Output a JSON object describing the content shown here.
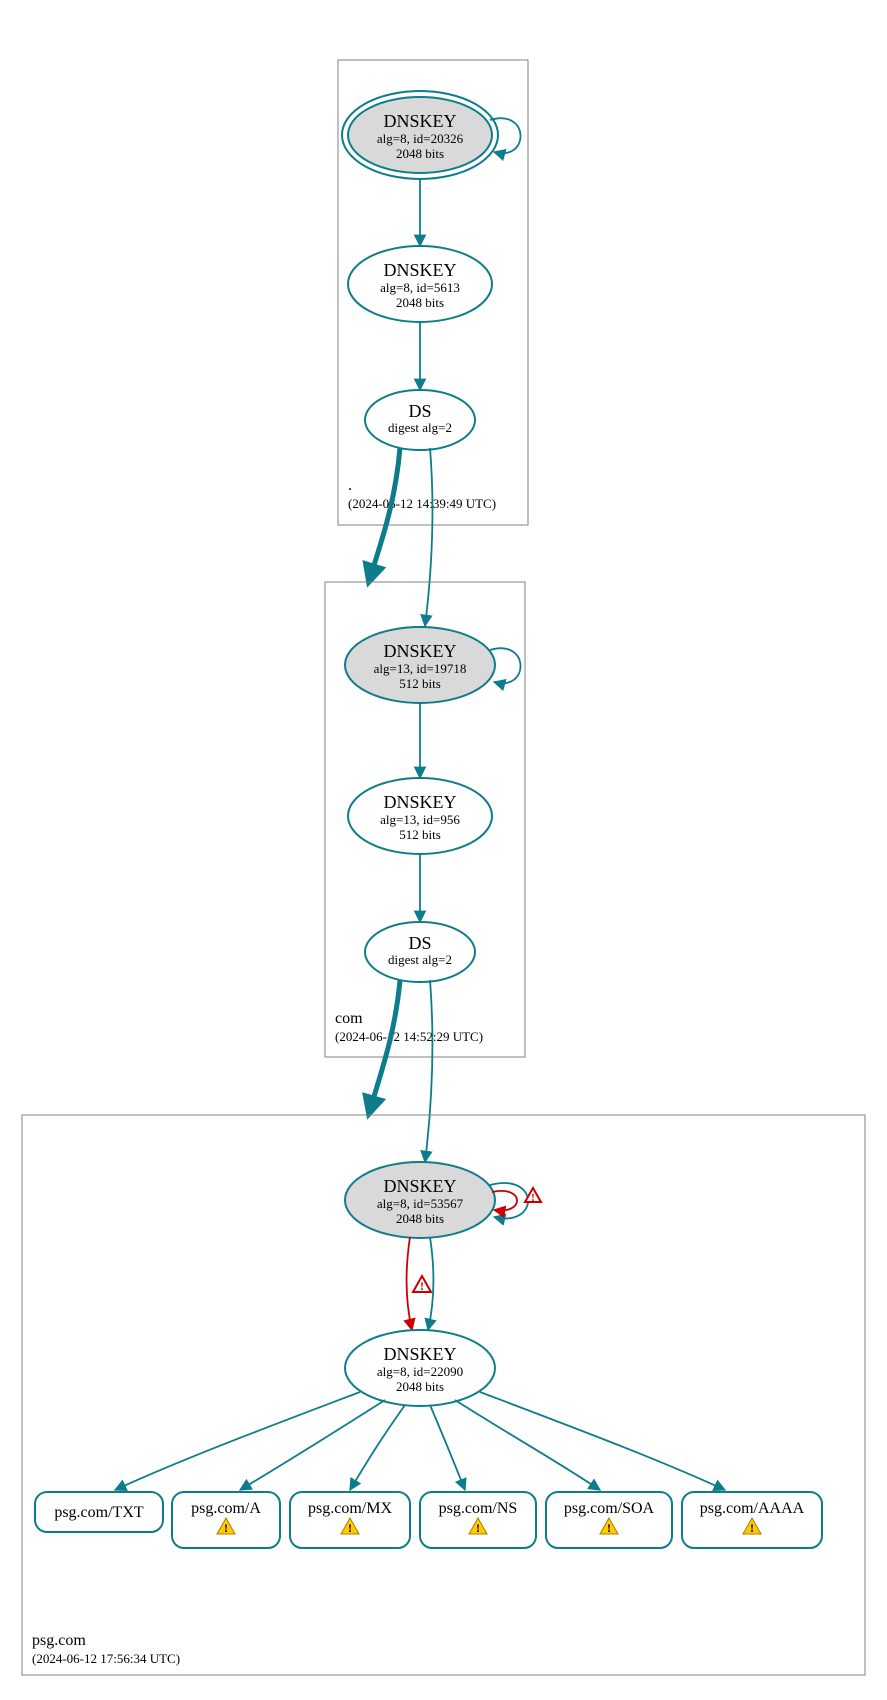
{
  "zones": {
    "root": {
      "label": ".",
      "timestamp": "(2024-06-12 14:39:49 UTC)",
      "nodes": {
        "ksk": {
          "title": "DNSKEY",
          "line1": "alg=8, id=20326",
          "line2": "2048 bits"
        },
        "zsk": {
          "title": "DNSKEY",
          "line1": "alg=8, id=5613",
          "line2": "2048 bits"
        },
        "ds": {
          "title": "DS",
          "line1": "digest alg=2"
        }
      }
    },
    "com": {
      "label": "com",
      "timestamp": "(2024-06-12 14:52:29 UTC)",
      "nodes": {
        "ksk": {
          "title": "DNSKEY",
          "line1": "alg=13, id=19718",
          "line2": "512 bits"
        },
        "zsk": {
          "title": "DNSKEY",
          "line1": "alg=13, id=956",
          "line2": "512 bits"
        },
        "ds": {
          "title": "DS",
          "line1": "digest alg=2"
        }
      }
    },
    "psg": {
      "label": "psg.com",
      "timestamp": "(2024-06-12 17:56:34 UTC)",
      "nodes": {
        "ksk": {
          "title": "DNSKEY",
          "line1": "alg=8, id=53567",
          "line2": "2048 bits"
        },
        "zsk": {
          "title": "DNSKEY",
          "line1": "alg=8, id=22090",
          "line2": "2048 bits"
        }
      }
    }
  },
  "rrsets": [
    {
      "label": "psg.com/TXT",
      "warn": false
    },
    {
      "label": "psg.com/A",
      "warn": true
    },
    {
      "label": "psg.com/MX",
      "warn": true
    },
    {
      "label": "psg.com/NS",
      "warn": true
    },
    {
      "label": "psg.com/SOA",
      "warn": true
    },
    {
      "label": "psg.com/AAAA",
      "warn": true
    }
  ],
  "icons": {
    "warn_triangle": "⚠",
    "error_triangle": "⚠"
  }
}
